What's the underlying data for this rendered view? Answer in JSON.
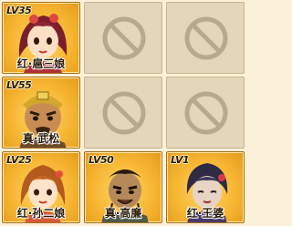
{
  "slots": [
    {
      "level": "LV35",
      "name": "红·扈三娘",
      "empty": false
    },
    {
      "empty": true
    },
    {
      "empty": true
    },
    {
      "level": "LV55",
      "name": "真·武松",
      "empty": false
    },
    {
      "empty": true
    },
    {
      "empty": true
    },
    {
      "level": "LV25",
      "name": "红·孙二娘",
      "empty": false
    },
    {
      "level": "LV50",
      "name": "真·高廉",
      "empty": false
    },
    {
      "level": "LV1",
      "name": "红·王婆",
      "empty": false
    }
  ],
  "colors": {
    "slot_gold": "#f7b633",
    "slot_empty": "#e4d6ba",
    "empty_symbol": "#b8a98c"
  }
}
